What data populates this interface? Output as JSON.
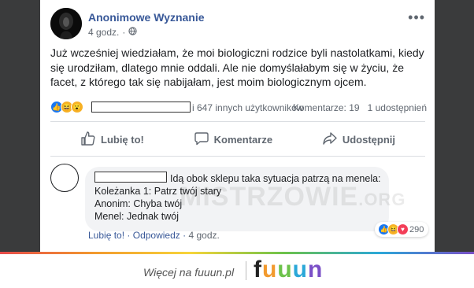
{
  "post": {
    "author": "Anonimowe Wyznanie",
    "time": "4 godz.",
    "text": "Już wcześniej wiedziałam, że moi biologiczni rodzice byli nastolatkami, kiedy się urodziłam, dlatego mnie oddali. Ale nie domyślałabym się w życiu, że facet, z którego tak się nabijałam, jest moim biologicznym ojcem.",
    "reactions_text": "i 647 innych użytkowników",
    "comments_count": "Komentarze: 19",
    "shares_count": "1 udostępnień",
    "reaction_icons": [
      "like-icon",
      "haha-icon",
      "wow-icon"
    ]
  },
  "actions": {
    "like": "Lubię to!",
    "comment": "Komentarze",
    "share": "Udostępnij"
  },
  "comment": {
    "line1": "Idą obok sklepu taka sytuacja patrzą na menela:",
    "line2": "Koleżanka 1: Patrz twój stary",
    "line3": "Anonim: Chyba twój",
    "line4": "Menel: Jednak twój",
    "like": "Lubię to!",
    "reply": "Odpowiedz",
    "time": "4 godz.",
    "reaction_count": "290",
    "reaction_icons": [
      "like-icon",
      "haha-icon",
      "love-icon"
    ]
  },
  "watermark": {
    "main": "MISTRZOWIE",
    "suffix": ".ORG"
  },
  "footer": {
    "more": "Więcej na fuuun.pl",
    "brand": "fuuun",
    "brand_colors": [
      "#e64a4a",
      "#f29a2e",
      "#6cc24a",
      "#2ba8d8",
      "#7a4fc7"
    ]
  }
}
